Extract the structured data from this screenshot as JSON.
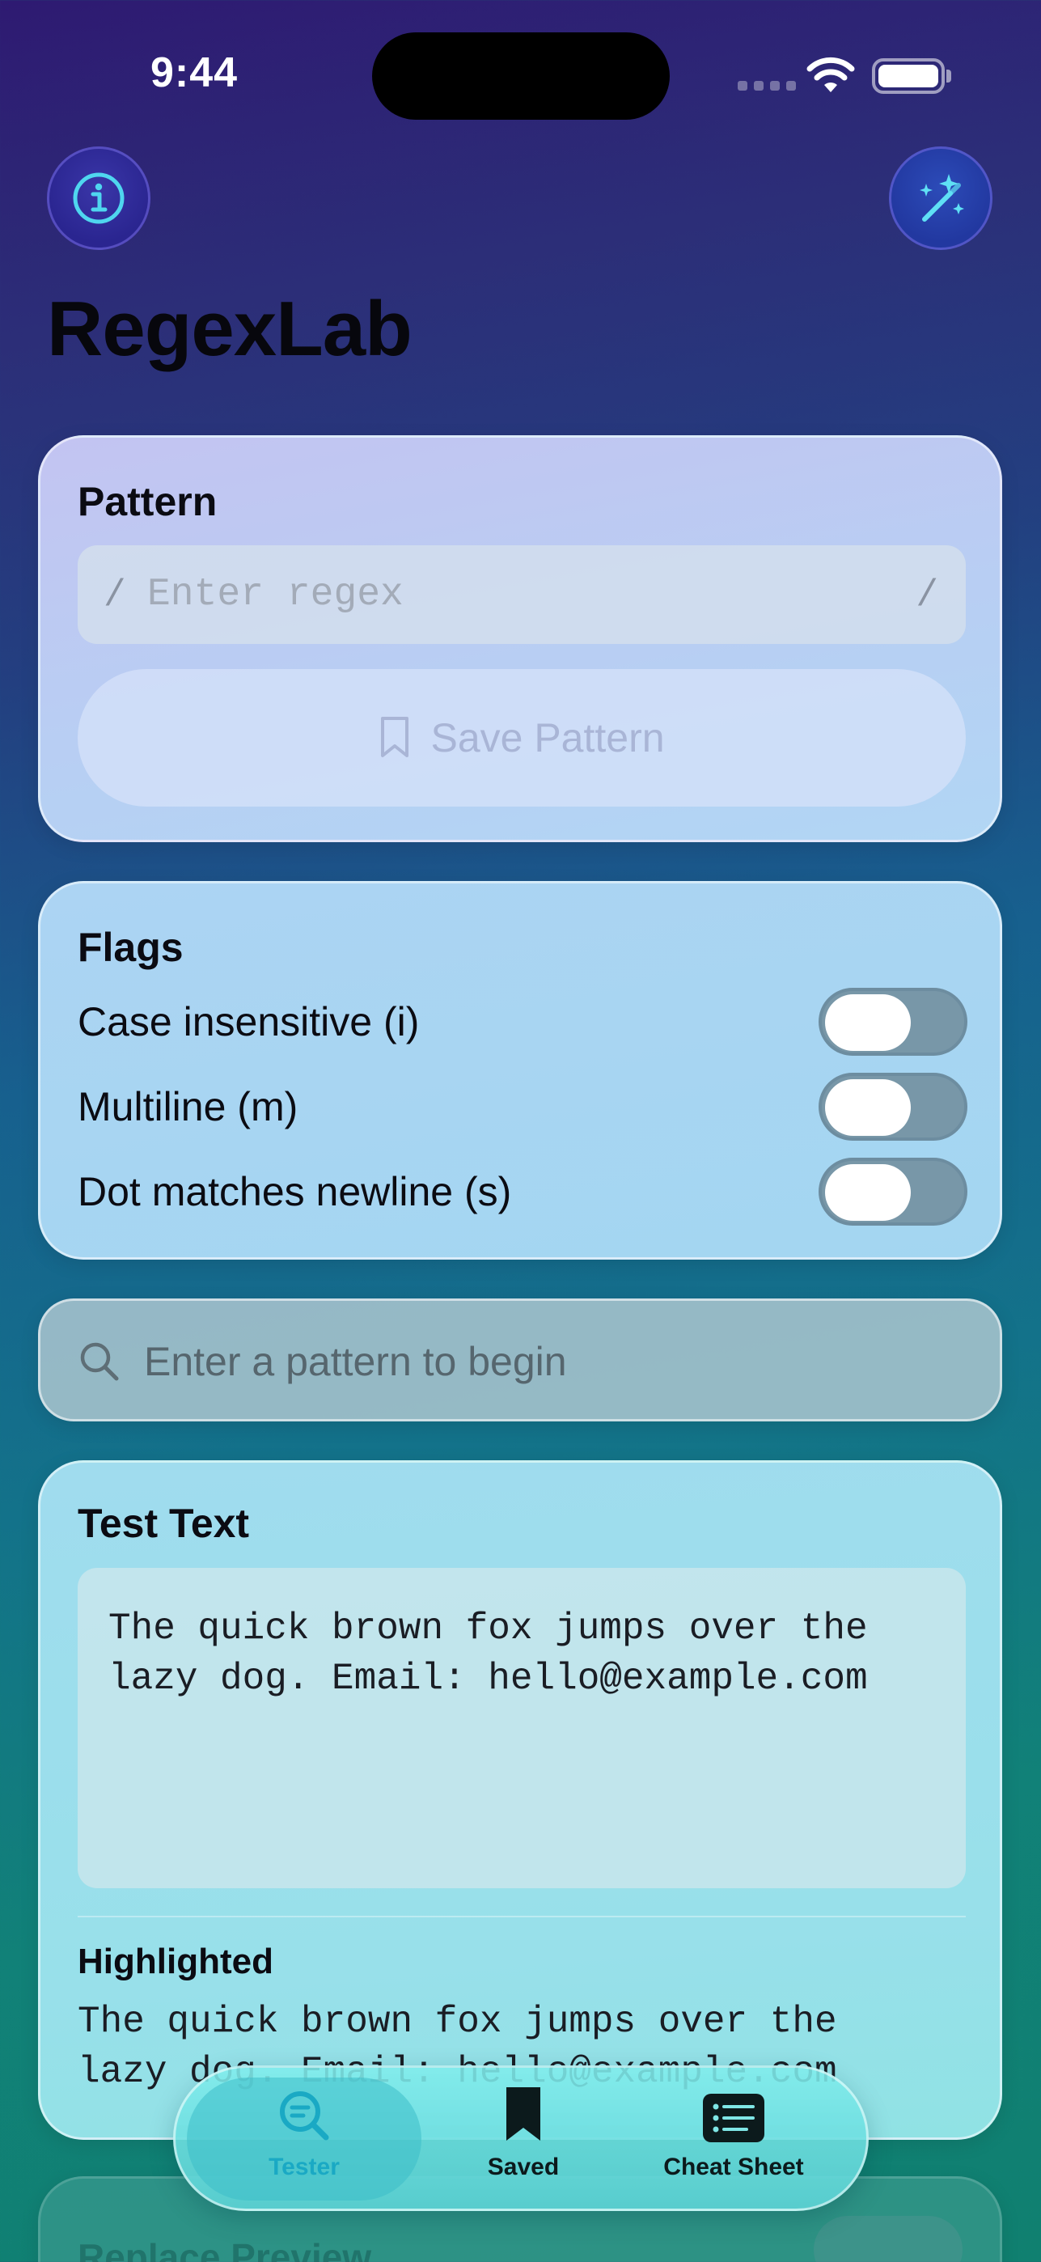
{
  "status_bar": {
    "time": "9:44"
  },
  "header": {
    "title": "RegexLab",
    "info_icon": "info-circle-icon",
    "wand_icon": "magic-wand-icon"
  },
  "pattern_card": {
    "title": "Pattern",
    "slash_left": "/",
    "slash_right": "/",
    "input_value": "",
    "input_placeholder": "Enter regex",
    "save_label": "Save Pattern",
    "save_icon": "bookmark-icon"
  },
  "flags_card": {
    "title": "Flags",
    "flags": [
      {
        "label": "Case insensitive (i)",
        "on": false
      },
      {
        "label": "Multiline (m)",
        "on": false
      },
      {
        "label": "Dot matches newline (s)",
        "on": false
      }
    ]
  },
  "status_card": {
    "icon": "search-icon",
    "text": "Enter a pattern to begin"
  },
  "test_card": {
    "title": "Test Text",
    "text": "The quick brown fox jumps over the\nlazy dog. Email: hello@example.com",
    "highlighted_title": "Highlighted",
    "highlighted_text": "The quick brown fox jumps over the\nlazy dog. Email: hello@example.com"
  },
  "replace_card": {
    "title": "Replace Preview"
  },
  "tabbar": {
    "tabs": [
      {
        "label": "Tester",
        "icon": "search-list-icon",
        "active": true
      },
      {
        "label": "Saved",
        "icon": "bookmark-fill-icon",
        "active": false
      },
      {
        "label": "Cheat Sheet",
        "icon": "list-board-icon",
        "active": false
      }
    ]
  },
  "colors": {
    "accent": "#1aa9c4",
    "toggle_off": "#7897a8"
  }
}
